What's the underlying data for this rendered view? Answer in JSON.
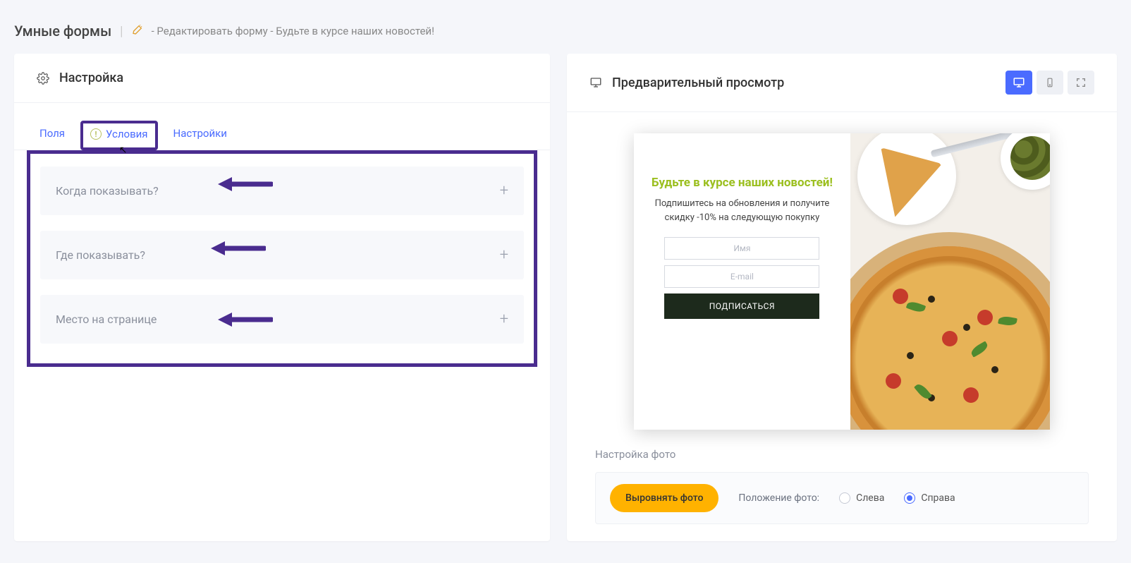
{
  "breadcrumb": {
    "title": "Умные формы",
    "trail": "- Редактировать форму - Будьте в курсе наших новостей!"
  },
  "left_panel": {
    "title": "Настройка",
    "tabs": {
      "fields": "Поля",
      "conditions": "Условия",
      "settings": "Настройки"
    },
    "accordion": {
      "when": "Когда показывать?",
      "where": "Где показывать?",
      "position": "Место на странице"
    }
  },
  "right_panel": {
    "title": "Предварительный просмотр",
    "popup": {
      "headline": "Будьте в курсе наших новостей!",
      "sub": "Подпишитесь на обновления и получите скидку -10% на следующую покупку",
      "name_placeholder": "Имя",
      "email_placeholder": "E-mail",
      "button": "ПОДПИСАТЬСЯ"
    },
    "photo_section": {
      "title": "Настройка фото",
      "align_button": "Выровнять фото",
      "position_label": "Положение фото:",
      "left_option": "Слева",
      "right_option": "Справа"
    }
  }
}
